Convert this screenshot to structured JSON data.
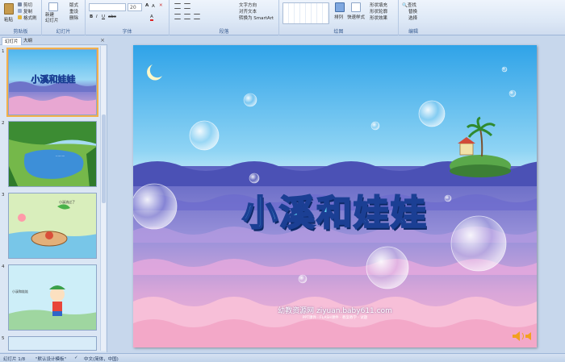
{
  "ribbon": {
    "clipboard": {
      "paste": "粘贴",
      "cut": "剪切",
      "copy": "复制",
      "format_painter": "格式刷",
      "label": "剪贴板"
    },
    "slides": {
      "new_slide": "新建\n幻灯片",
      "layout": "版式",
      "reset": "重设",
      "delete": "删除",
      "label": "幻灯片"
    },
    "font": {
      "size": "20",
      "label": "字体"
    },
    "paragraph": {
      "text_direction": "文字方向",
      "align_text": "对齐文本",
      "smartart": "转换为 SmartArt",
      "label": "段落"
    },
    "drawing": {
      "arrange": "排列",
      "quick_styles": "快速样式",
      "shape_fill": "形状填充",
      "shape_outline": "形状轮廓",
      "shape_effects": "形状效果",
      "label": "绘图"
    },
    "editing": {
      "find": "查找",
      "replace": "替换",
      "select": "选择",
      "label": "编辑"
    }
  },
  "panel": {
    "tabs": [
      "幻灯片",
      "大纲"
    ],
    "close": "×",
    "slide_numbers": [
      "1",
      "2",
      "3",
      "4",
      "5"
    ],
    "thumb3_text": "小溪流过了",
    "thumb4_text": "小溪和娃娃"
  },
  "slide": {
    "title": "小溪和娃娃",
    "watermark": "幼教资源网 ziyuan.baby611.com",
    "submark": "PPT课件 · FLASH课件 · 教案教学 · 试题"
  },
  "status": {
    "slide_count": "幻灯片 1/8",
    "theme": "\"默认设计模板\"",
    "language": "中文(简体，中国)"
  },
  "colors": {
    "ribbon_label": "#3b5f94",
    "selected_outline": "#f3b04a",
    "title_fill": "#5ecff0",
    "title_stroke": "#1b3f94"
  }
}
